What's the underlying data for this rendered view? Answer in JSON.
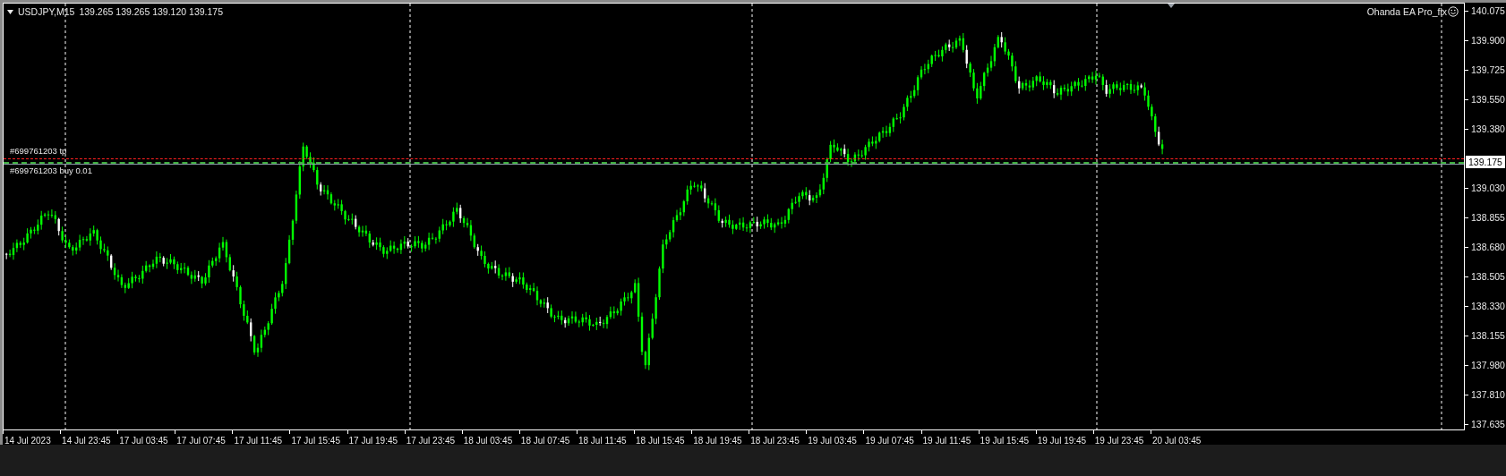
{
  "chart": {
    "symbol": "USDJPY,M15",
    "ohlc": "139.265 139.265 139.120 139.175",
    "expert": "Ohanda EA Pro_fix",
    "orders": [
      {
        "kind": "tp",
        "label": "#699761203 tp"
      },
      {
        "kind": "entry",
        "label": "#699761203 buy 0.01"
      }
    ],
    "current_price": "139.175",
    "price_axis_upper": [
      "140.075",
      "139.900",
      "139.725",
      "139.550",
      "139.380"
    ],
    "price_axis_lower": [
      "139.030",
      "138.855",
      "138.680",
      "138.505",
      "138.330",
      "138.155",
      "137.980",
      "137.810",
      "137.635"
    ],
    "time_axis": [
      "14 Jul 2023",
      "14 Jul 23:45",
      "17 Jul 03:45",
      "17 Jul 07:45",
      "17 Jul 11:45",
      "17 Jul 15:45",
      "17 Jul 19:45",
      "17 Jul 23:45",
      "18 Jul 03:45",
      "18 Jul 07:45",
      "18 Jul 11:45",
      "18 Jul 15:45",
      "18 Jul 19:45",
      "18 Jul 23:45",
      "19 Jul 03:45",
      "19 Jul 07:45",
      "19 Jul 11:45",
      "19 Jul 15:45",
      "19 Jul 19:45",
      "19 Jul 23:45",
      "20 Jul 03:45"
    ]
  }
}
